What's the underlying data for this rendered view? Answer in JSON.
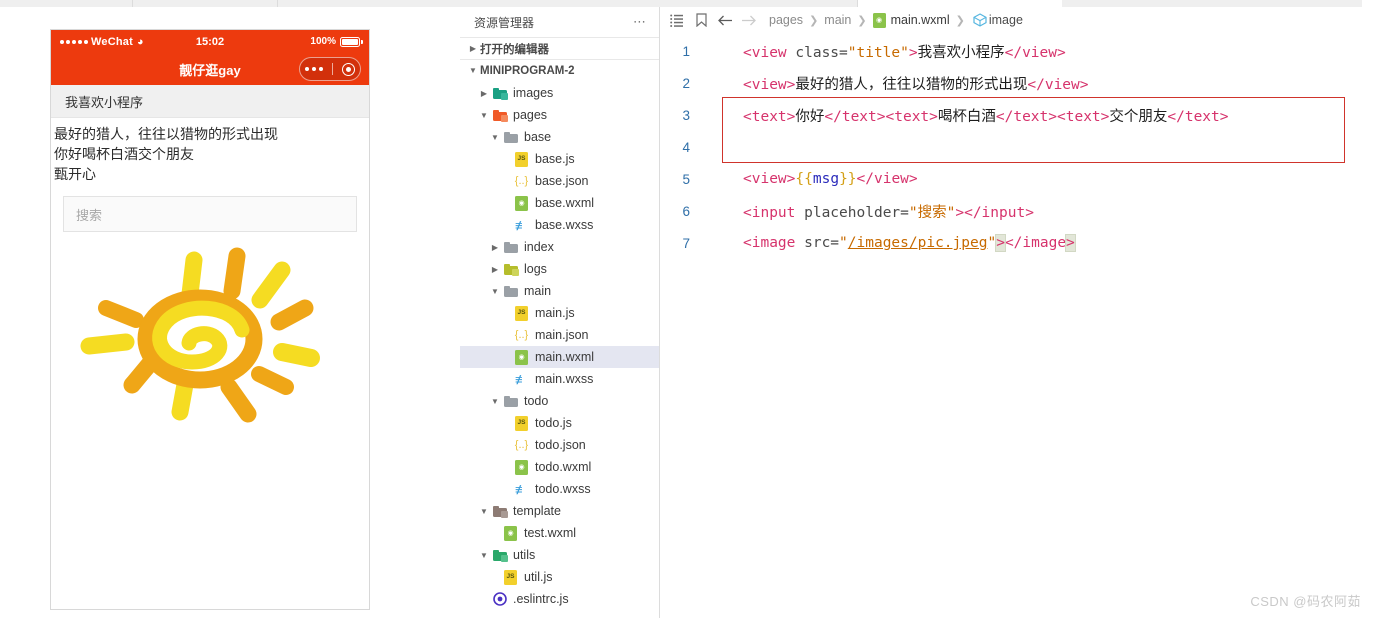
{
  "window": {
    "tabstrip_segments": [
      133,
      145,
      345,
      90
    ]
  },
  "simulator": {
    "statusbar": {
      "carrier": "WeChat",
      "wifi_icon": "wifi-icon",
      "time": "15:02",
      "battery_percent": "100%",
      "battery_icon": "battery-icon"
    },
    "navbar": {
      "title": "靓仔逛gay",
      "capsule_more_icon": "more-dots-icon",
      "capsule_target_icon": "target-circle-icon"
    },
    "page": {
      "title": "我喜欢小程序",
      "lines": [
        "最好的猎人，往往以猎物的形式出现",
        "你好喝杯白酒交个朋友",
        "甄开心"
      ],
      "input_placeholder": "搜索",
      "image_alt": "sun-drawing"
    }
  },
  "explorer": {
    "header_title": "资源管理器",
    "header_more_icon": "ellipsis-icon",
    "open_editors_label": "打开的编辑器",
    "project_label": "MINIPROGRAM-2",
    "tree": [
      {
        "label": "images",
        "kind": "folder",
        "depth": 1,
        "twisty": "right",
        "icon": "folder-images-icon",
        "selected": false
      },
      {
        "label": "pages",
        "kind": "folder",
        "depth": 1,
        "twisty": "down",
        "icon": "folder-pages-icon",
        "selected": false
      },
      {
        "label": "base",
        "kind": "folder",
        "depth": 2,
        "twisty": "down",
        "icon": "folder-icon",
        "selected": false
      },
      {
        "label": "base.js",
        "kind": "js",
        "depth": 3,
        "twisty": "none",
        "icon": "js-file-icon",
        "selected": false
      },
      {
        "label": "base.json",
        "kind": "json",
        "depth": 3,
        "twisty": "none",
        "icon": "json-file-icon",
        "selected": false
      },
      {
        "label": "base.wxml",
        "kind": "wxml",
        "depth": 3,
        "twisty": "none",
        "icon": "wxml-file-icon",
        "selected": false
      },
      {
        "label": "base.wxss",
        "kind": "wxss",
        "depth": 3,
        "twisty": "none",
        "icon": "wxss-file-icon",
        "selected": false
      },
      {
        "label": "index",
        "kind": "folder",
        "depth": 2,
        "twisty": "right",
        "icon": "folder-icon",
        "selected": false
      },
      {
        "label": "logs",
        "kind": "folder",
        "depth": 2,
        "twisty": "right",
        "icon": "folder-logs-icon",
        "selected": false
      },
      {
        "label": "main",
        "kind": "folder",
        "depth": 2,
        "twisty": "down",
        "icon": "folder-icon",
        "selected": false
      },
      {
        "label": "main.js",
        "kind": "js",
        "depth": 3,
        "twisty": "none",
        "icon": "js-file-icon",
        "selected": false
      },
      {
        "label": "main.json",
        "kind": "json",
        "depth": 3,
        "twisty": "none",
        "icon": "json-file-icon",
        "selected": false
      },
      {
        "label": "main.wxml",
        "kind": "wxml",
        "depth": 3,
        "twisty": "none",
        "icon": "wxml-file-icon",
        "selected": true
      },
      {
        "label": "main.wxss",
        "kind": "wxss",
        "depth": 3,
        "twisty": "none",
        "icon": "wxss-file-icon",
        "selected": false
      },
      {
        "label": "todo",
        "kind": "folder",
        "depth": 2,
        "twisty": "down",
        "icon": "folder-icon",
        "selected": false
      },
      {
        "label": "todo.js",
        "kind": "js",
        "depth": 3,
        "twisty": "none",
        "icon": "js-file-icon",
        "selected": false
      },
      {
        "label": "todo.json",
        "kind": "json",
        "depth": 3,
        "twisty": "none",
        "icon": "json-file-icon",
        "selected": false
      },
      {
        "label": "todo.wxml",
        "kind": "wxml",
        "depth": 3,
        "twisty": "none",
        "icon": "wxml-file-icon",
        "selected": false
      },
      {
        "label": "todo.wxss",
        "kind": "wxss",
        "depth": 3,
        "twisty": "none",
        "icon": "wxss-file-icon",
        "selected": false
      },
      {
        "label": "template",
        "kind": "folder",
        "depth": 1,
        "twisty": "down",
        "icon": "folder-template-icon",
        "selected": false
      },
      {
        "label": "test.wxml",
        "kind": "wxml",
        "depth": 2,
        "twisty": "none",
        "icon": "wxml-file-icon",
        "selected": false
      },
      {
        "label": "utils",
        "kind": "folder",
        "depth": 1,
        "twisty": "down",
        "icon": "folder-utils-icon",
        "selected": false
      },
      {
        "label": "util.js",
        "kind": "js",
        "depth": 2,
        "twisty": "none",
        "icon": "js-file-icon",
        "selected": false
      },
      {
        "label": ".eslintrc.js",
        "kind": "eslint",
        "depth": 1,
        "twisty": "none",
        "icon": "eslint-file-icon",
        "selected": false
      }
    ]
  },
  "editor": {
    "toolbar_icons": [
      "outline-list-icon",
      "bookmark-icon",
      "back-arrow-icon",
      "forward-arrow-icon"
    ],
    "breadcrumb": [
      "pages",
      "main",
      "main.wxml",
      "image"
    ],
    "breadcrumb_file_icon": "wxml-file-icon",
    "breadcrumb_symbol_icon": "cube-symbol-icon",
    "lines": [
      {
        "n": "1",
        "tokens": [
          {
            "t": "tag",
            "v": "<view"
          },
          {
            "t": "attr",
            "v": " class="
          },
          {
            "t": "str",
            "v": "\"title\""
          },
          {
            "t": "tag",
            "v": ">"
          },
          {
            "t": "txt",
            "v": "我喜欢小程序"
          },
          {
            "t": "tag",
            "v": "</view>"
          }
        ]
      },
      {
        "n": "2",
        "tokens": [
          {
            "t": "tag",
            "v": "<view>"
          },
          {
            "t": "txt",
            "v": "最好的猎人，往往以猎物的形式出现"
          },
          {
            "t": "tag",
            "v": "</view>"
          }
        ]
      },
      {
        "n": "3",
        "tokens": [
          {
            "t": "tag",
            "v": "<text>"
          },
          {
            "t": "txt",
            "v": "你好"
          },
          {
            "t": "tag",
            "v": "</text><text>"
          },
          {
            "t": "txt",
            "v": "喝杯白酒"
          },
          {
            "t": "tag",
            "v": "</text><text>"
          },
          {
            "t": "txt",
            "v": "交个朋友"
          },
          {
            "t": "tag",
            "v": "</text>"
          }
        ]
      },
      {
        "n": "4",
        "tokens": []
      },
      {
        "n": "5",
        "tokens": [
          {
            "t": "tag",
            "v": "<view>"
          },
          {
            "t": "brace",
            "v": "{{"
          },
          {
            "t": "mus",
            "v": "msg"
          },
          {
            "t": "brace",
            "v": "}}"
          },
          {
            "t": "tag",
            "v": "</view>"
          }
        ]
      },
      {
        "n": "6",
        "tokens": [
          {
            "t": "tag",
            "v": "<input"
          },
          {
            "t": "attr",
            "v": " placeholder="
          },
          {
            "t": "str",
            "v": "\"搜索\""
          },
          {
            "t": "tag",
            "v": ">"
          },
          {
            "t": "tag",
            "v": "</input>"
          }
        ]
      },
      {
        "n": "7",
        "tokens": [
          {
            "t": "tag",
            "v": "<image"
          },
          {
            "t": "attr",
            "v": " src="
          },
          {
            "t": "str",
            "v": "\""
          },
          {
            "t": "link",
            "v": "/images/pic.jpeg"
          },
          {
            "t": "str",
            "v": "\""
          },
          {
            "t": "tag-hl",
            "v": ">"
          },
          {
            "t": "tag",
            "v": "</image"
          },
          {
            "t": "tag-hl",
            "v": ">"
          }
        ]
      }
    ]
  },
  "watermark": "CSDN @码农阿茹",
  "colors": {
    "wechat_orange": "#ED3A0E",
    "selection_blue": "#e4e6f1",
    "linenum_blue": "#2f6fa8",
    "tag_pink": "#d6336c",
    "string_orange": "#c76a00",
    "redbox": "#d0342c",
    "sun_yellow": "#F5DC22",
    "sun_orange": "#EFA617"
  }
}
